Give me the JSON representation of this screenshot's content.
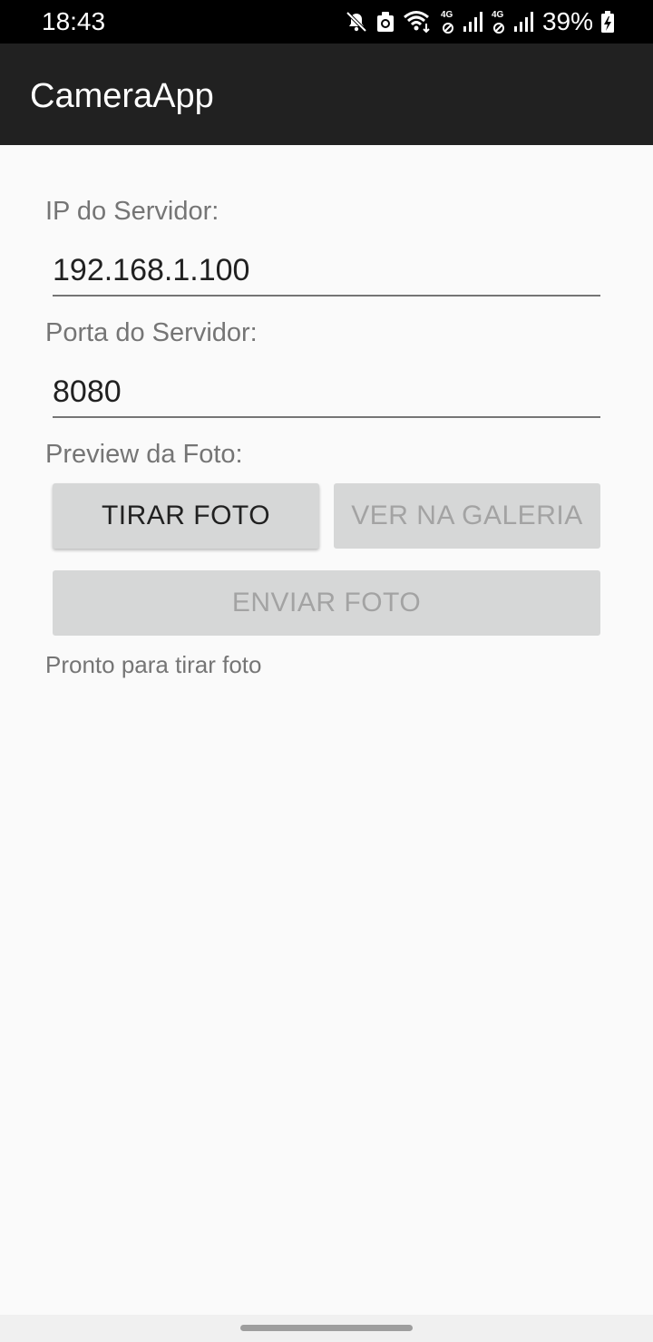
{
  "status_bar": {
    "time": "18:43",
    "network_label_1": "4G",
    "network_label_2": "4G",
    "battery_percent": "39%",
    "icons": [
      "mute-icon",
      "sync-icon",
      "wifi-icon",
      "signal-icon",
      "signal-icon",
      "battery-charging-icon"
    ]
  },
  "app_bar": {
    "title": "CameraApp"
  },
  "form": {
    "ip_label": "IP do Servidor:",
    "ip_value": "192.168.1.100",
    "port_label": "Porta do Servidor:",
    "port_value": "8080",
    "preview_label": "Preview da Foto:"
  },
  "buttons": {
    "take_photo": "TIRAR FOTO",
    "view_gallery": "VER NA GALERIA",
    "send_photo": "ENVIAR FOTO"
  },
  "status_message": "Pronto para tirar foto"
}
